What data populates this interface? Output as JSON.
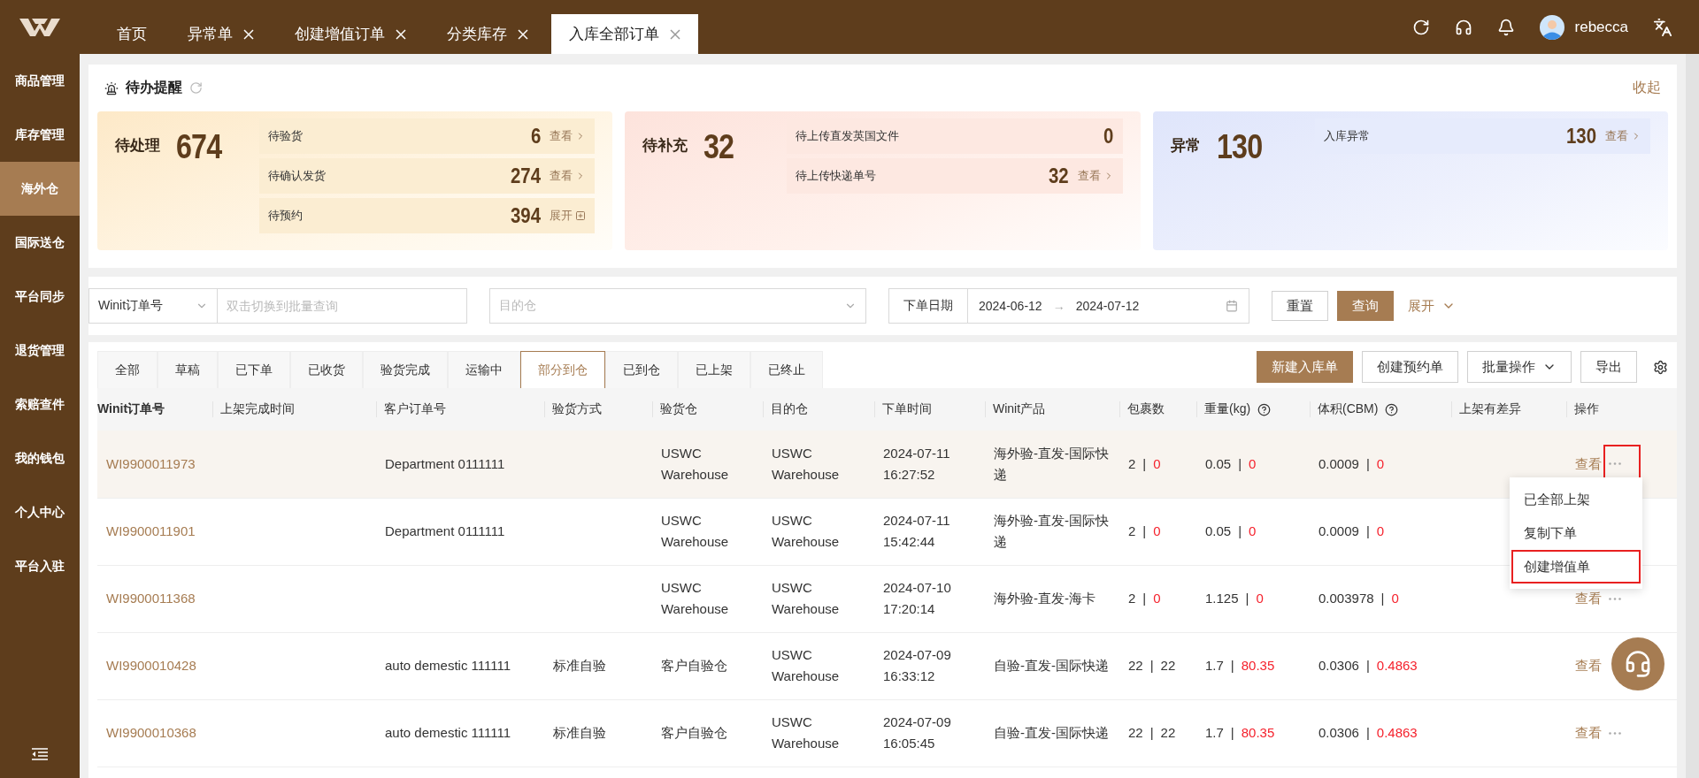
{
  "top_tabs": [
    {
      "label": "首页",
      "closable": false,
      "selected": false
    },
    {
      "label": "异常单",
      "closable": true,
      "selected": false
    },
    {
      "label": "创建增值订单",
      "closable": true,
      "selected": false
    },
    {
      "label": "分类库存",
      "closable": true,
      "selected": false
    },
    {
      "label": "入库全部订单",
      "closable": true,
      "selected": true
    }
  ],
  "user": {
    "name": "rebecca"
  },
  "sidebar": {
    "items": [
      {
        "label": "商品管理",
        "selected": false
      },
      {
        "label": "库存管理",
        "selected": false
      },
      {
        "label": "海外仓",
        "selected": true
      },
      {
        "label": "国际送仓",
        "selected": false
      },
      {
        "label": "平台同步",
        "selected": false
      },
      {
        "label": "退货管理",
        "selected": false
      },
      {
        "label": "索赔查件",
        "selected": false
      },
      {
        "label": "我的钱包",
        "selected": false
      },
      {
        "label": "个人中心",
        "selected": false
      },
      {
        "label": "平台入驻",
        "selected": false
      }
    ]
  },
  "reminders": {
    "title": "待办提醒",
    "collapse": "收起",
    "cards": [
      {
        "kind": "pending",
        "label": "待处理",
        "total": "674",
        "items": [
          {
            "label": "待验货",
            "count": "6",
            "action": "查看",
            "kind": "view"
          },
          {
            "label": "待确认发货",
            "count": "274",
            "action": "查看",
            "kind": "view"
          },
          {
            "label": "待预约",
            "count": "394",
            "action": "展开",
            "kind": "expand"
          }
        ]
      },
      {
        "kind": "supplement",
        "label": "待补充",
        "total": "32",
        "items": [
          {
            "label": "待上传直发英国文件",
            "count": "0",
            "kind": "plain"
          },
          {
            "label": "待上传快递单号",
            "count": "32",
            "action": "查看",
            "kind": "view"
          }
        ]
      },
      {
        "kind": "exception",
        "label": "异常",
        "total": "130",
        "items": [
          {
            "label": "入库异常",
            "count": "130",
            "action": "查看",
            "kind": "view"
          }
        ]
      }
    ]
  },
  "filters": {
    "order_type": "Winit订单号",
    "search": {
      "placeholder": "双击切换到批量查询"
    },
    "warehouse": {
      "placeholder": "目的仓"
    },
    "date_label": "下单日期",
    "date_from": "2024-06-12",
    "date_separator": "→",
    "date_to": "2024-07-12",
    "reset": "重置",
    "query": "查询",
    "expand": "展开"
  },
  "status_tabs": [
    {
      "label": "全部",
      "selected": false
    },
    {
      "label": "草稿",
      "selected": false
    },
    {
      "label": "已下单",
      "selected": false
    },
    {
      "label": "已收货",
      "selected": false
    },
    {
      "label": "验货完成",
      "selected": false
    },
    {
      "label": "运输中",
      "selected": false
    },
    {
      "label": "部分到仓",
      "selected": true
    },
    {
      "label": "已到仓",
      "selected": false
    },
    {
      "label": "已上架",
      "selected": false
    },
    {
      "label": "已终止",
      "selected": false
    }
  ],
  "toolbar": {
    "buttons": [
      {
        "label": "新建入库单",
        "kind": "primary"
      },
      {
        "label": "创建预约单",
        "kind": "plain"
      },
      {
        "label": "批量操作",
        "kind": "dropdown"
      },
      {
        "label": "导出",
        "kind": "plain"
      }
    ]
  },
  "table": {
    "columns": [
      {
        "label": "Winit订单号"
      },
      {
        "label": "上架完成时间"
      },
      {
        "label": "客户订单号"
      },
      {
        "label": "验货方式"
      },
      {
        "label": "验货仓"
      },
      {
        "label": "目的仓"
      },
      {
        "label": "下单时间"
      },
      {
        "label": "Winit产品"
      },
      {
        "label": "包裹数"
      },
      {
        "label": "重量(kg)",
        "help": true
      },
      {
        "label": "体积(CBM)",
        "help": true
      },
      {
        "label": "上架有差异"
      },
      {
        "label": "操作"
      }
    ],
    "rows": [
      {
        "hovered": true,
        "order_no": "WI9900011973",
        "customer_order": "Department 0111111",
        "inspection": "",
        "inspect_wh": "USWC Warehouse",
        "dest_wh": "USWC Warehouse",
        "ordered_at": "2024-07-11 16:27:52",
        "product": "海外验-直发-国际快递",
        "packages": {
          "declared": "2",
          "separator": "|",
          "actual": "0",
          "alert": true
        },
        "weight": {
          "declared": "0.05",
          "separator": "|",
          "actual": "0",
          "alert": true
        },
        "volume": {
          "declared": "0.0009",
          "separator": "|",
          "actual": "0",
          "alert": true
        },
        "view": "查看",
        "more": true,
        "more_highlighted": true
      },
      {
        "hovered": false,
        "order_no": "WI9900011901",
        "customer_order": "Department 0111111",
        "inspection": "",
        "inspect_wh": "USWC Warehouse",
        "dest_wh": "USWC Warehouse",
        "ordered_at": "2024-07-11 15:42:44",
        "product": "海外验-直发-国际快递",
        "packages": {
          "declared": "2",
          "separator": "|",
          "actual": "0",
          "alert": true
        },
        "weight": {
          "declared": "0.05",
          "separator": "|",
          "actual": "0",
          "alert": true
        },
        "volume": {
          "declared": "0.0009",
          "separator": "|",
          "actual": "0",
          "alert": true
        },
        "more": false
      },
      {
        "hovered": false,
        "order_no": "WI9900011368",
        "customer_order": "",
        "inspection": "",
        "inspect_wh": "USWC Warehouse",
        "dest_wh": "USWC Warehouse",
        "ordered_at": "2024-07-10 17:20:14",
        "product": "海外验-直发-海卡",
        "packages": {
          "declared": "2",
          "separator": "|",
          "actual": "0",
          "alert": true
        },
        "weight": {
          "declared": "1.125",
          "separator": "|",
          "actual": "0",
          "alert": true
        },
        "volume": {
          "declared": "0.003978",
          "separator": "|",
          "actual": "0",
          "alert": true
        },
        "view": "查看",
        "more": true,
        "more_highlighted": false
      },
      {
        "hovered": false,
        "order_no": "WI9900010428",
        "customer_order": "auto demestic 111111",
        "inspection": "标准自验",
        "inspect_wh": "客户自验仓",
        "dest_wh": "USWC Warehouse",
        "ordered_at": "2024-07-09 16:33:12",
        "product": "自验-直发-国际快递",
        "packages": {
          "declared": "22",
          "separator": "|",
          "actual": "22",
          "alert": false
        },
        "weight": {
          "declared": "1.7",
          "separator": "|",
          "actual": "80.35",
          "alert": true
        },
        "volume": {
          "declared": "0.0306",
          "separator": "|",
          "actual": "0.4863",
          "alert": true
        },
        "view": "查看",
        "more": false
      },
      {
        "hovered": false,
        "order_no": "WI9900010368",
        "customer_order": "auto demestic 111111",
        "inspection": "标准自验",
        "inspect_wh": "客户自验仓",
        "dest_wh": "USWC Warehouse",
        "ordered_at": "2024-07-09 16:05:45",
        "product": "自验-直发-国际快递",
        "packages": {
          "declared": "22",
          "separator": "|",
          "actual": "22",
          "alert": false
        },
        "weight": {
          "declared": "1.7",
          "separator": "|",
          "actual": "80.35",
          "alert": true
        },
        "volume": {
          "declared": "0.0306",
          "separator": "|",
          "actual": "0.4863",
          "alert": true
        },
        "view": "查看",
        "more": true,
        "more_highlighted": false
      }
    ],
    "row_menu": {
      "items": [
        {
          "label": "已全部上架",
          "highlighted": false
        },
        {
          "label": "复制下单",
          "highlighted": false
        },
        {
          "label": "创建增值单",
          "highlighted": true
        }
      ]
    }
  }
}
